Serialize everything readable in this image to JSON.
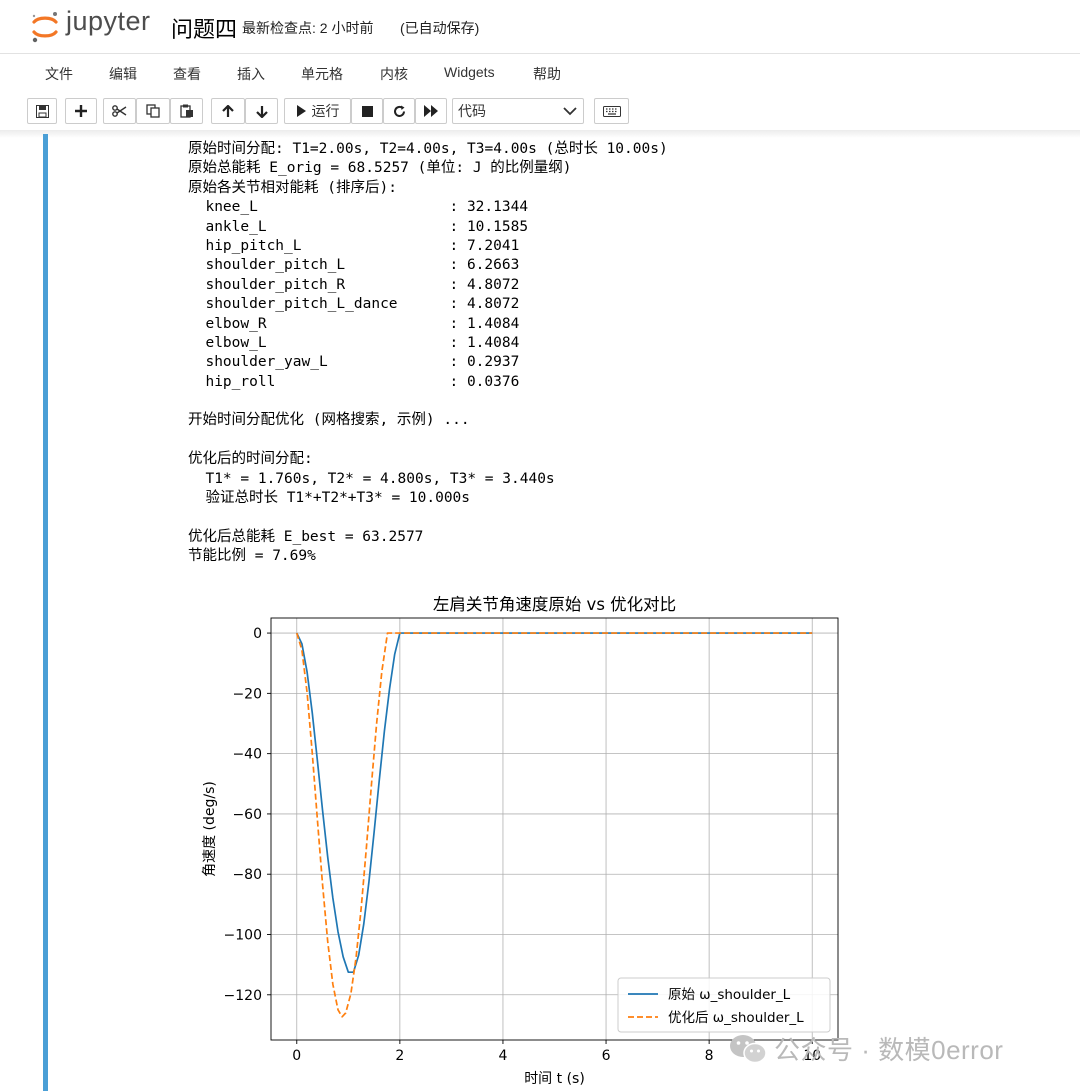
{
  "header": {
    "logo_text": "jupyter",
    "notebook_title": "问题四",
    "checkpoint": "最新检查点: 2 小时前",
    "autosave": "(已自动保存)"
  },
  "menu": [
    "文件",
    "编辑",
    "查看",
    "插入",
    "单元格",
    "内核",
    "Widgets",
    "帮助"
  ],
  "toolbar": {
    "run_label": "运行",
    "cell_type": "代码"
  },
  "output": {
    "line1": "原始时间分配: T1=2.00s, T2=4.00s, T3=4.00s (总时长 10.00s)",
    "line2": "原始总能耗 E_orig = 68.5257 (单位: J 的比例量纲)",
    "line3": "原始各关节相对能耗 (排序后):",
    "joints": [
      {
        "name": "knee_L",
        "value": "32.1344"
      },
      {
        "name": "ankle_L",
        "value": "10.1585"
      },
      {
        "name": "hip_pitch_L",
        "value": "7.2041"
      },
      {
        "name": "shoulder_pitch_L",
        "value": "6.2663"
      },
      {
        "name": "shoulder_pitch_R",
        "value": "4.8072"
      },
      {
        "name": "shoulder_pitch_L_dance",
        "value": "4.8072"
      },
      {
        "name": "elbow_R",
        "value": "1.4084"
      },
      {
        "name": "elbow_L",
        "value": "1.4084"
      },
      {
        "name": "shoulder_yaw_L",
        "value": "0.2937"
      },
      {
        "name": "hip_roll",
        "value": "0.0376"
      }
    ],
    "opt_start": "开始时间分配优化 (网格搜索, 示例) ...",
    "opt_header": "优化后的时间分配:",
    "opt_times": "  T1* = 1.760s, T2* = 4.800s, T3* = 3.440s",
    "opt_verify": "  验证总时长 T1*+T2*+T3* = 10.000s",
    "e_best": "优化后总能耗 E_best = 63.2577",
    "saving": "节能比例 = 7.69%"
  },
  "chart_data": {
    "type": "line",
    "title": "左肩关节角速度原始 vs 优化对比",
    "xlabel": "时间 t (s)",
    "ylabel": "角速度 (deg/s)",
    "xlim": [
      -0.5,
      10.5
    ],
    "ylim": [
      -135,
      5
    ],
    "xticks": [
      0,
      2,
      4,
      6,
      8,
      10
    ],
    "yticks": [
      0,
      -20,
      -40,
      -60,
      -80,
      -100,
      -120
    ],
    "grid": true,
    "legend_position": "bottom-right",
    "series": [
      {
        "name": "原始 ω_shoulder_L",
        "style": "solid",
        "color": "#1f77b4",
        "x": [
          0,
          0.1,
          0.2,
          0.3,
          0.4,
          0.5,
          0.6,
          0.7,
          0.8,
          0.9,
          1.0,
          1.1,
          1.2,
          1.3,
          1.4,
          1.5,
          1.6,
          1.7,
          1.8,
          1.9,
          2.0,
          10.0
        ],
        "y": [
          0,
          -3.6,
          -12.9,
          -26.4,
          -42.3,
          -58.8,
          -74.3,
          -87.9,
          -99.1,
          -107.4,
          -112.5,
          -112.5,
          -106.9,
          -96.5,
          -82.5,
          -66.1,
          -48.9,
          -32.5,
          -18.5,
          -7.0,
          0,
          0
        ]
      },
      {
        "name": "优化后 ω_shoulder_L",
        "style": "dashed",
        "color": "#ff7f0e",
        "x": [
          0,
          0.1,
          0.2,
          0.3,
          0.4,
          0.5,
          0.6,
          0.7,
          0.8,
          0.88,
          0.95,
          1.05,
          1.15,
          1.25,
          1.35,
          1.45,
          1.55,
          1.65,
          1.76,
          10.0
        ],
        "y": [
          0,
          -5.7,
          -19.7,
          -39.7,
          -61.9,
          -83.4,
          -102.3,
          -116.5,
          -125.0,
          -127.3,
          -126.0,
          -119.6,
          -107.7,
          -91.2,
          -71.3,
          -50.0,
          -29.8,
          -12.8,
          0,
          0
        ]
      }
    ]
  },
  "watermark": {
    "text": "公众号 · 数模0error"
  }
}
